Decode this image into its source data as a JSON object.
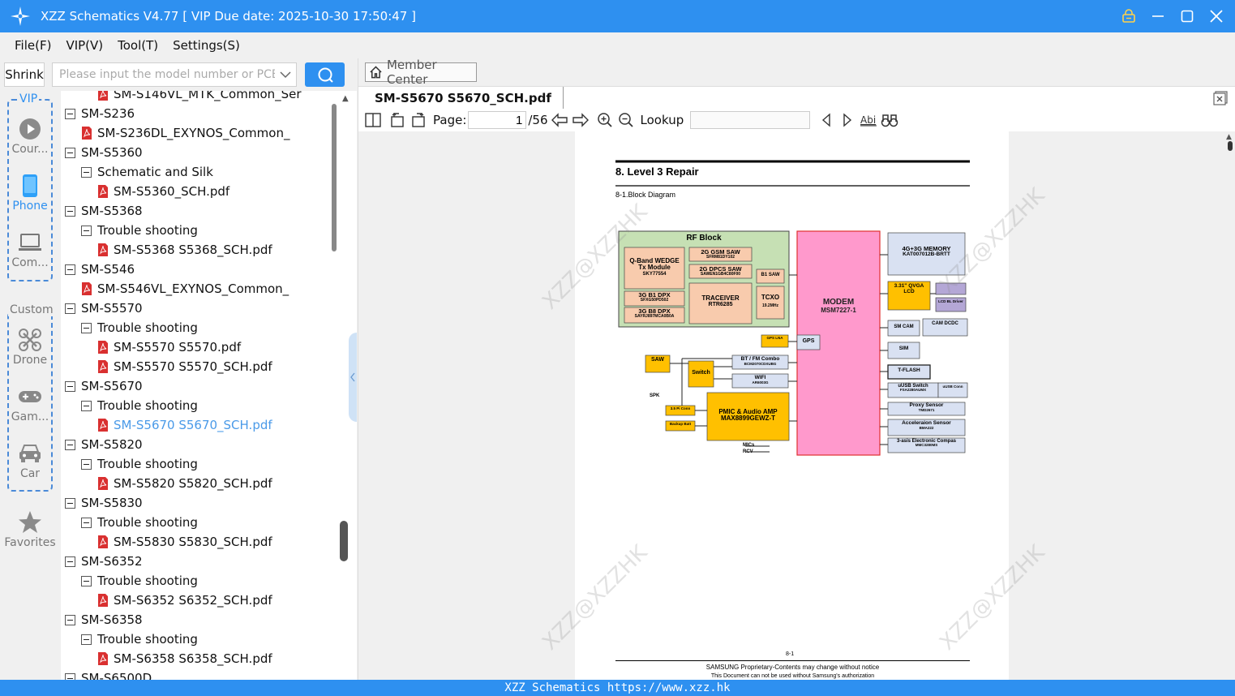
{
  "window": {
    "title": "XZZ Schematics V4.77 [ VIP Due date: 2025-10-30 17:50:47 ]"
  },
  "menu": [
    "File(F)",
    "VIP(V)",
    "Tool(T)",
    "Settings(S)"
  ],
  "toolbar": {
    "shrink_label": "Shrink",
    "search_placeholder": "Please input the model number or PCB"
  },
  "categories": {
    "vip_label": "VIP",
    "custom_label": "Custom",
    "items": [
      {
        "label": "Cour...",
        "icon": "play-icon"
      },
      {
        "label": "Phone",
        "icon": "phone-icon"
      },
      {
        "label": "Com...",
        "icon": "laptop-icon"
      },
      {
        "label": "Drone",
        "icon": "drone-icon"
      },
      {
        "label": "Gam...",
        "icon": "gamepad-icon"
      },
      {
        "label": "Car",
        "icon": "car-icon"
      },
      {
        "label": "Favorites",
        "icon": "star-icon"
      }
    ]
  },
  "tree": [
    {
      "level": 2,
      "type": "pdf",
      "label": "SM-S146VL_MTK_Common_Ser"
    },
    {
      "level": 0,
      "type": "folder",
      "label": "SM-S236"
    },
    {
      "level": 1,
      "type": "pdf",
      "label": "SM-S236DL_EXYNOS_Common_"
    },
    {
      "level": 0,
      "type": "folder",
      "label": "SM-S5360"
    },
    {
      "level": 1,
      "type": "folder",
      "label": "Schematic and Silk"
    },
    {
      "level": 2,
      "type": "pdf",
      "label": "SM-S5360_SCH.pdf"
    },
    {
      "level": 0,
      "type": "folder",
      "label": "SM-S5368"
    },
    {
      "level": 1,
      "type": "folder",
      "label": "Trouble shooting"
    },
    {
      "level": 2,
      "type": "pdf",
      "label": "SM-S5368 S5368_SCH.pdf"
    },
    {
      "level": 0,
      "type": "folder",
      "label": "SM-S546"
    },
    {
      "level": 1,
      "type": "pdf",
      "label": "SM-S546VL_EXYNOS_Common_"
    },
    {
      "level": 0,
      "type": "folder",
      "label": "SM-S5570"
    },
    {
      "level": 1,
      "type": "folder",
      "label": "Trouble shooting"
    },
    {
      "level": 2,
      "type": "pdf",
      "label": "SM-S5570 S5570.pdf"
    },
    {
      "level": 2,
      "type": "pdf",
      "label": "SM-S5570 S5570_SCH.pdf"
    },
    {
      "level": 0,
      "type": "folder",
      "label": "SM-S5670"
    },
    {
      "level": 1,
      "type": "folder",
      "label": "Trouble shooting"
    },
    {
      "level": 2,
      "type": "pdf",
      "label": "SM-S5670 S5670_SCH.pdf",
      "selected": true
    },
    {
      "level": 0,
      "type": "folder",
      "label": "SM-S5820"
    },
    {
      "level": 1,
      "type": "folder",
      "label": "Trouble shooting"
    },
    {
      "level": 2,
      "type": "pdf",
      "label": "SM-S5820 S5820_SCH.pdf"
    },
    {
      "level": 0,
      "type": "folder",
      "label": "SM-S5830"
    },
    {
      "level": 1,
      "type": "folder",
      "label": "Trouble shooting"
    },
    {
      "level": 2,
      "type": "pdf",
      "label": "SM-S5830 S5830_SCH.pdf"
    },
    {
      "level": 0,
      "type": "folder",
      "label": "SM-S6352"
    },
    {
      "level": 1,
      "type": "folder",
      "label": "Trouble shooting"
    },
    {
      "level": 2,
      "type": "pdf",
      "label": "SM-S6352 S6352_SCH.pdf"
    },
    {
      "level": 0,
      "type": "folder",
      "label": "SM-S6358"
    },
    {
      "level": 1,
      "type": "folder",
      "label": "Trouble shooting"
    },
    {
      "level": 2,
      "type": "pdf",
      "label": "SM-S6358 S6358_SCH.pdf"
    },
    {
      "level": 0,
      "type": "folder",
      "label": "SM-S6500D"
    }
  ],
  "viewer": {
    "member_center": "Member Center",
    "tab_title": "SM-S5670 S5670_SCH.pdf",
    "page_label": "Page:",
    "page_current": "1",
    "page_total": "/56",
    "lookup_label": "Lookup"
  },
  "doc": {
    "heading": "8.  Level  3  Repair",
    "subheading": "8-1.Block  Diagram",
    "page_no": "8-1",
    "footer1": "SAMSUNG Proprietary-Contents may change without notice",
    "footer2": "This Document can not be used without Samsung's authorization",
    "watermark": "XZZ@XZZHK",
    "blocks": {
      "rf_block": "RF Block",
      "qband_l1": "Q-Band WEDGE",
      "qband_l2": "Tx Module",
      "qband_l3": "SKY77554",
      "gsm_saw_l1": "2G GSM SAW",
      "gsm_saw_l2": "SFRM81DY102",
      "dpcs_saw_l1": "2G DPCS SAW",
      "dpcs_saw_l2": "SAWEN1GB4C80F00",
      "b1saw": "B1 SAW",
      "b1dpx_l1": "3G B1 DPX",
      "b1dpx_l2": "SFXG50PD502",
      "b8dpx_l1": "3G B8 DPX",
      "b8dpx_l2": "SAYRJ897MCA0B0A",
      "tracer_l1": "TRACEIVER",
      "tracer_l2": "RTR6285",
      "tcxo_l1": "TCXO",
      "tcxo_l2": "19.2MHz",
      "modem_l1": "MODEM",
      "modem_l2": "MSM7227-1",
      "mem_l1": "4G+3G MEMORY",
      "mem_l2": "KAT007012B-BRTT",
      "lcd_l1": "3.31\" QVGA",
      "lcd_l2": "LCD",
      "lcdbl": "LCD BL Driver",
      "smcam": "SM CAM",
      "camdcdc": "CAM DCDC",
      "sim": "SIM",
      "tflash": "T-FLASH",
      "usbsw_l1": "uUSB Switch",
      "usbsw_l2": "FSA2280AUMX",
      "usbcon": "uUSB Conn",
      "proxy_l1": "Proxy Sensor",
      "proxy_l2": "TMD2671",
      "accel_l1": "Acceleraion Sensor",
      "accel_l2": "BMA222",
      "compass_l1": "3-asis Electronic Compas",
      "compass_l2": "MMC3280MS",
      "gps": "GPS",
      "gpslna": "GPS LNA",
      "saw": "SAW",
      "switch": "Switch",
      "bt_l1": "BT / FM Combo",
      "bt_l2": "BCM2070CDXUBG",
      "wifi_l1": "WIFI",
      "wifi_l2": "AR6003G",
      "pmic_l1": "PMIC & Audio AMP",
      "pmic_l2": "MAX8899GEWZ-T",
      "spk": "SPK",
      "conn35": "3.5 Pi Conn",
      "backup": "Backup Batt",
      "mics": "MICs",
      "rcv": "RCV"
    }
  },
  "status": {
    "text": "XZZ Schematics https://www.xzz.hk"
  },
  "colors": {
    "accent": "#2e90f0",
    "selected_text": "#4a9ae8",
    "modem": "#ff99cc",
    "rf_block": "#c6e0b4",
    "rf_part": "#f8cbad",
    "yellow_part": "#ffc000",
    "blue_part": "#d9e1f2"
  }
}
